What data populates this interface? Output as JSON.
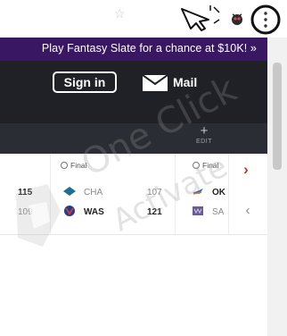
{
  "toolbar": {
    "star_icon": "star-icon",
    "extension_icon": "bug-icon",
    "menu_icon": "vertical-dots-icon",
    "highlight_color": "#111111"
  },
  "promo": {
    "text": "Play Fantasy Slate for a chance at $10K! »",
    "background": "#3a1763"
  },
  "header": {
    "sign_in_label": "Sign in",
    "mail_label": "Mail",
    "background": "#1f2126"
  },
  "subbar": {
    "edit_symbol": "+",
    "edit_label": "EDIT"
  },
  "scores": {
    "games": [
      {
        "status": "Final",
        "away": {
          "score": "115"
        },
        "home": {
          "score": "109"
        },
        "teams": [
          {
            "abbr": "CHA",
            "logo": "hornets-logo"
          },
          {
            "abbr": "WAS",
            "logo": "wizards-logo"
          }
        ]
      },
      {
        "status": "Final",
        "scores": [
          "107",
          "121"
        ],
        "teams": [
          {
            "abbr": "OK",
            "logo": "thunder-logo"
          },
          {
            "abbr": "SA",
            "logo": "kings-logo"
          }
        ]
      }
    ],
    "next_icon": "chevron-right-icon",
    "prev_icon": "chevron-left-icon",
    "accent": "#c0392b"
  },
  "watermark": {
    "line1": "One Click",
    "line2": "Activate"
  }
}
